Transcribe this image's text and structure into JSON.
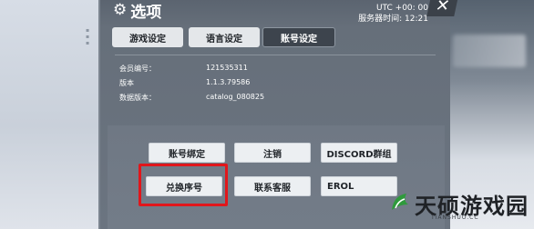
{
  "window": {
    "title": "选项",
    "icon": "gear-icon"
  },
  "clock": {
    "utc": "UTC +00: 00",
    "server_time": "服务器时间: 12:21"
  },
  "tabs": [
    {
      "label": "游戏设定",
      "active": false
    },
    {
      "label": "语言设定",
      "active": false
    },
    {
      "label": "账号设定",
      "active": true
    }
  ],
  "account_info": [
    {
      "label": "会员编号：",
      "value": "121535311"
    },
    {
      "label": "版本",
      "value": "1.1.3.79586"
    },
    {
      "label": "数据版本：",
      "value": "catalog_080825"
    }
  ],
  "buttons": {
    "bind_account": "账号绑定",
    "logout": "注销",
    "discord": "DISCORD群组",
    "redeem_code": "兑换序号",
    "contact_support": "联系客服",
    "erolabs": "EROL"
  },
  "watermark": {
    "title": "天硕游戏园",
    "subtitle": "TIANSHUO.CC"
  },
  "colors": {
    "highlight": "#e1161b",
    "panel": "#666f7a"
  }
}
